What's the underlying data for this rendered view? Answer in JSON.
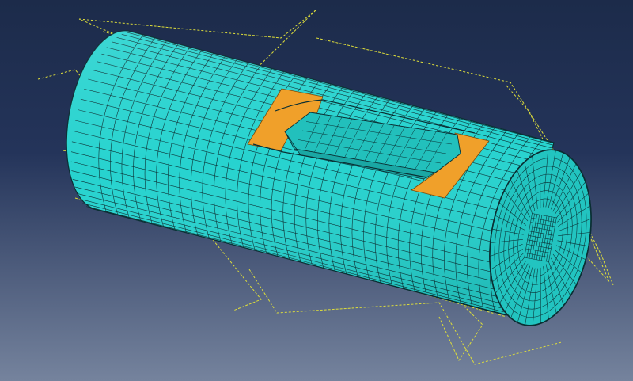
{
  "viewport": {
    "background_top": "#1c2b4a",
    "background_bottom": "#75839d"
  },
  "model": {
    "part": "cylinder-shaft",
    "mesh_color": "#27d3cf",
    "mesh_edge_color": "#0a2f33",
    "feature": "keyway-slot",
    "feature_color": "#f0a02a",
    "datum_plane_color": "#dede3a",
    "datum_plane_style": "dashed"
  }
}
